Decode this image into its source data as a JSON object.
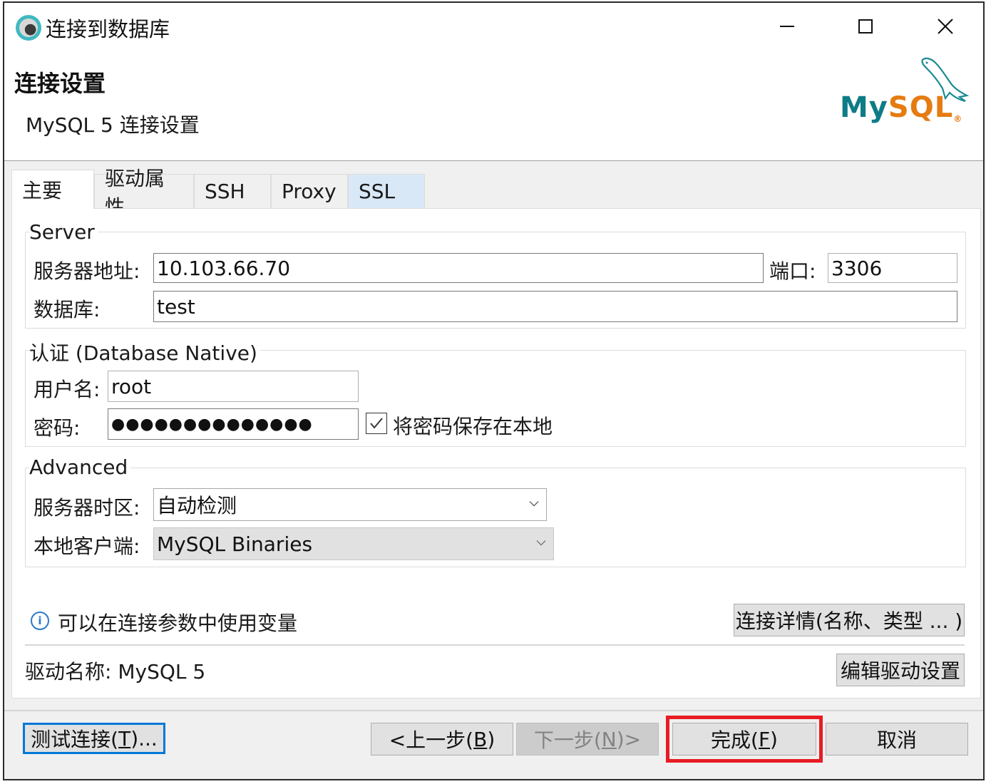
{
  "window": {
    "title": "连接到数据库",
    "controls": [
      "minimize",
      "maximize",
      "close"
    ]
  },
  "header": {
    "title": "连接设置",
    "subtitle": "MySQL 5 连接设置",
    "logo": {
      "my": "My",
      "sql": "SQL",
      "reg": "®",
      "colors": {
        "my": "#0d7c86",
        "sql": "#e57b11"
      }
    }
  },
  "tabs": [
    {
      "label": "主要",
      "active": true
    },
    {
      "label": "驱动属性",
      "active": false
    },
    {
      "label": "SSH",
      "active": false
    },
    {
      "label": "Proxy",
      "active": false
    },
    {
      "label": "SSL",
      "active": false,
      "hovered": true
    }
  ],
  "server": {
    "group_label": "Server",
    "host_label": "服务器地址:",
    "host_value": "10.103.66.70",
    "port_label": "端口:",
    "port_value": "3306",
    "database_label": "数据库:",
    "database_value": "test"
  },
  "auth": {
    "group_label": "认证 (Database Native)",
    "username_label": "用户名:",
    "username_value": "root",
    "password_label": "密码:",
    "password_value": "●●●●●●●●●●●●●●",
    "save_password_label": "将密码保存在本地",
    "save_password_checked": true
  },
  "advanced": {
    "group_label": "Advanced",
    "timezone_label": "服务器时区:",
    "timezone_value": "自动检测",
    "client_label": "本地客户端:",
    "client_value": "MySQL Binaries"
  },
  "info": {
    "text": "可以在连接参数中使用变量",
    "details_button": "连接详情(名称、类型 ... )"
  },
  "driver": {
    "label": "驱动名称:",
    "value": "MySQL 5",
    "edit_button": "编辑驱动设置"
  },
  "footer": {
    "test_connection": {
      "text": "测试连接(",
      "mnemonic": "T",
      "suffix": ")..."
    },
    "back": {
      "text": "<上一步(",
      "mnemonic": "B",
      "suffix": ")"
    },
    "next": {
      "text": "下一步(",
      "mnemonic": "N",
      "suffix": ")>"
    },
    "finish": {
      "text": "完成(",
      "mnemonic": "F",
      "suffix": ")"
    },
    "cancel": "取消",
    "highlight_color": "#e81c24"
  }
}
